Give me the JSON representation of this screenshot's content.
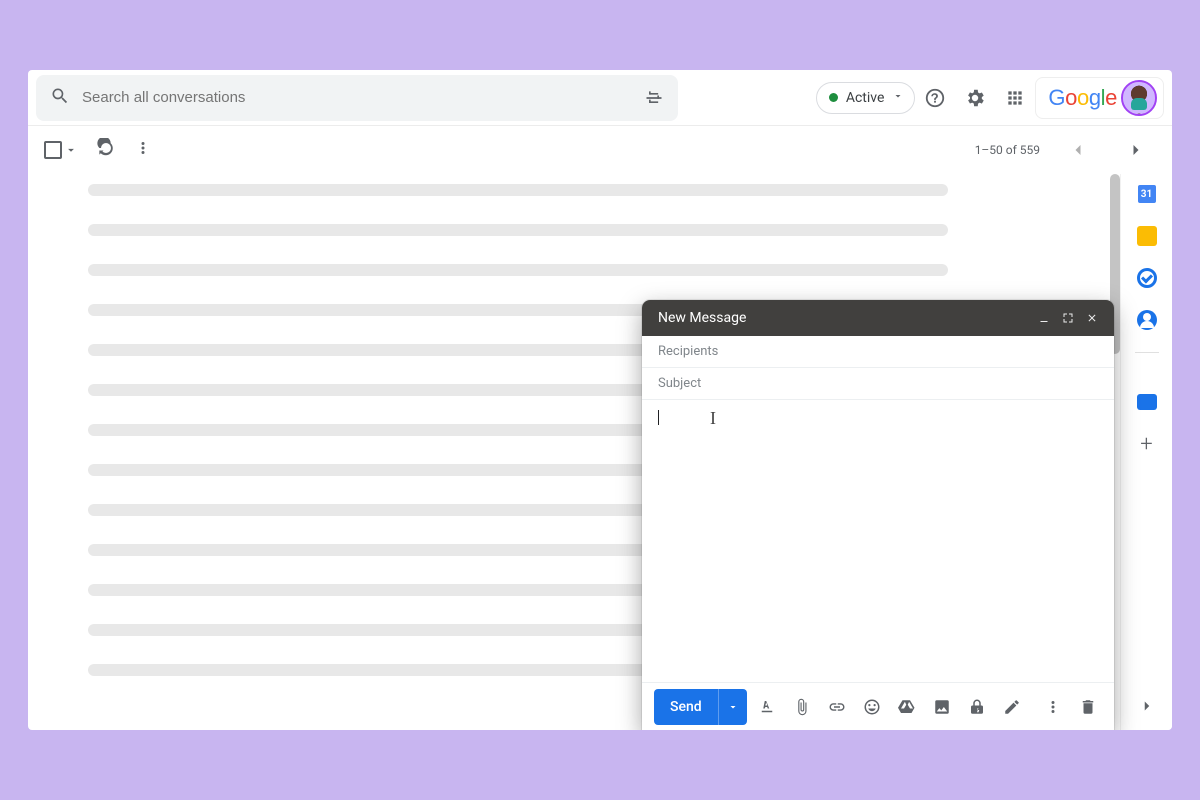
{
  "search": {
    "placeholder": "Search all conversations"
  },
  "status": {
    "label": "Active"
  },
  "logo": {
    "brand": "Google"
  },
  "toolbar": {
    "page_info": "1–50 of 559"
  },
  "compose": {
    "title": "New Message",
    "recipients_placeholder": "Recipients",
    "subject_placeholder": "Subject",
    "send_label": "Send"
  },
  "sidepanel": {
    "items": [
      "calendar",
      "keep",
      "tasks",
      "contacts",
      "meet",
      "add"
    ]
  }
}
